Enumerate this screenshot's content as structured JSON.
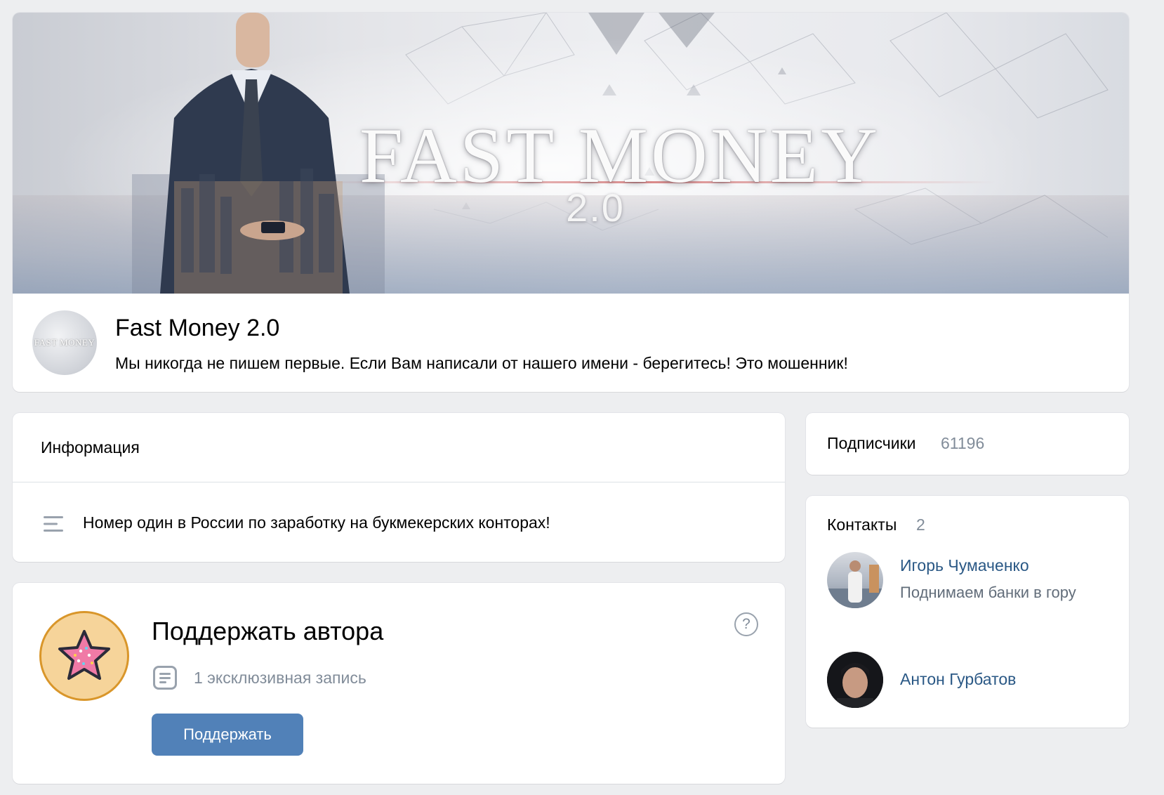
{
  "cover": {
    "title": "FAST MONEY",
    "subtitle": "2.0"
  },
  "group": {
    "name": "Fast Money 2.0",
    "status": "Мы никогда не пишем первые. Если Вам написали от нашего имени - берегитесь! Это мошенник!",
    "avatar_text": "FAST MONEY"
  },
  "info": {
    "title": "Информация",
    "description": "Номер один в России по заработку на букмекерских конторах!",
    "icon": "text-lines-icon"
  },
  "support": {
    "title": "Поддержать автора",
    "exclusive_posts": "1 эксклюзивная запись",
    "button_label": "Поддержать",
    "help_label": "?",
    "badge_icon": "donut-star-icon",
    "button_color": "#5181b8"
  },
  "subscribers": {
    "label": "Подписчики",
    "count": "61196"
  },
  "contacts": {
    "label": "Контакты",
    "count": "2",
    "items": [
      {
        "name": "Игорь Чумаченко",
        "description": "Поднимаем банки в гору"
      },
      {
        "name": "Антон Гурбатов",
        "description": ""
      }
    ],
    "link_color": "#2a5885"
  }
}
